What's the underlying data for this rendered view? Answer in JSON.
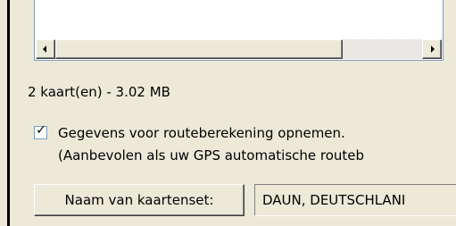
{
  "map_list": {
    "scroll_left_icon": "triangle-left",
    "scroll_right_icon": "triangle-right",
    "scroll_position": 0
  },
  "summary": {
    "text": "2 kaart(en) - 3.02 MB"
  },
  "routing_option": {
    "checked": true,
    "label_line1": "Gegevens voor routeberekening opnemen.",
    "label_line2": "(Aanbevolen als uw GPS automatische routeb"
  },
  "mapset": {
    "button_label": "Naam van kaartenset:",
    "name_value": "DAUN, DEUTSCHLANI"
  },
  "colors": {
    "window_background": "#ece9d8",
    "field_border": "#7f9db9"
  }
}
